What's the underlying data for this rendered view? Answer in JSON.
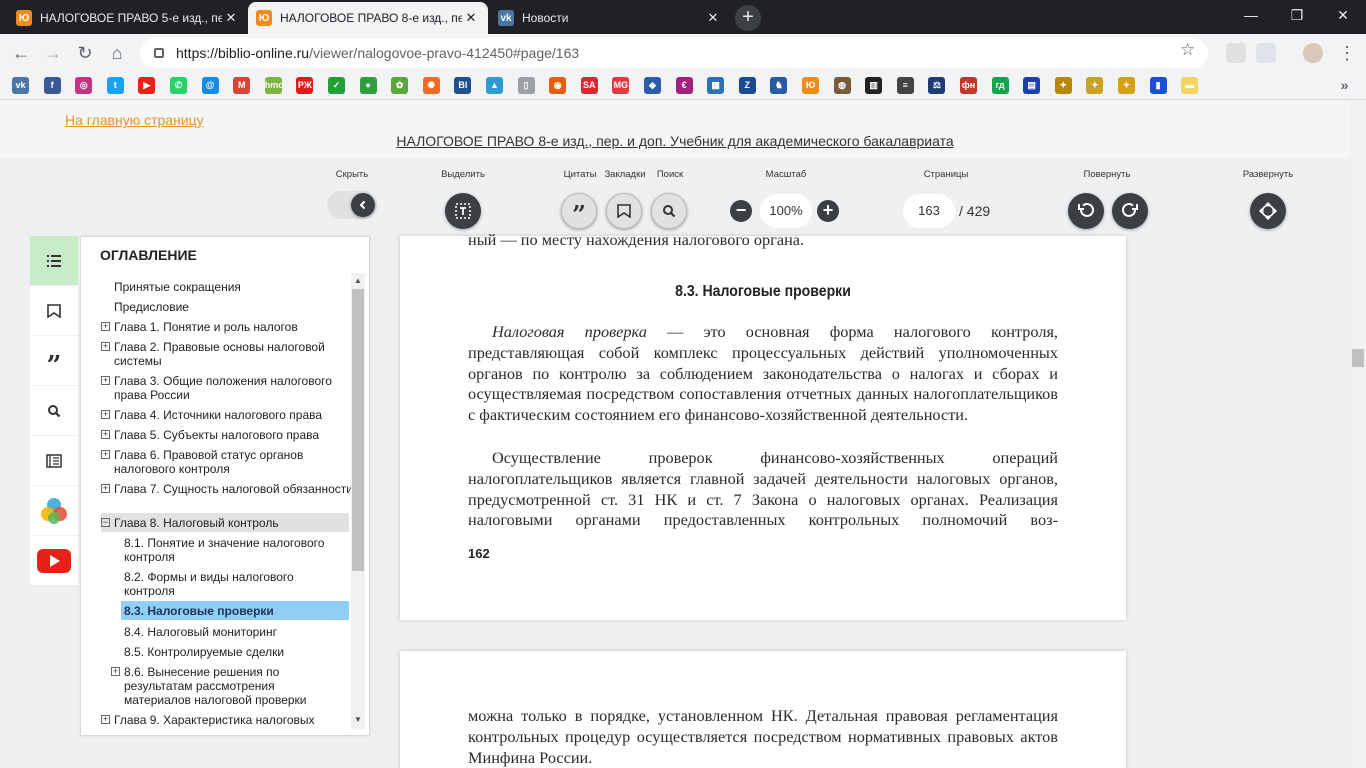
{
  "browser": {
    "tabs": [
      {
        "title": "НАЛОГОВОЕ ПРАВО 5-е изд., пе",
        "close": "✕",
        "active": false,
        "icon_color": "#f08c1e"
      },
      {
        "title": "НАЛОГОВОЕ ПРАВО 8-е изд., пе",
        "close": "✕",
        "active": true,
        "icon_color": "#f08c1e"
      },
      {
        "title": "Новости",
        "close": "✕",
        "active": false,
        "icon_color": "#4a76a8"
      }
    ],
    "new_tab": "+",
    "window_controls": {
      "minimize": "—",
      "maximize": "❐",
      "close": "✕"
    },
    "url_host": "https://biblio-online.ru",
    "url_path": "/viewer/nalogovoe-pravo-412450#page/163",
    "bookmarks": [
      {
        "icon": "vk-icon",
        "color": "#4a76a8",
        "glyph": "vk"
      },
      {
        "icon": "facebook-icon",
        "color": "#3b5998",
        "glyph": "f"
      },
      {
        "icon": "instagram-icon",
        "color": "#c13584",
        "glyph": "◎"
      },
      {
        "icon": "twitter-icon",
        "color": "#1da1f2",
        "glyph": "t"
      },
      {
        "icon": "youtube-icon",
        "color": "#e62117",
        "glyph": "▶"
      },
      {
        "icon": "whatsapp-icon",
        "color": "#25d366",
        "glyph": "✆"
      },
      {
        "icon": "mail-at-icon",
        "color": "#168de2",
        "glyph": "@"
      },
      {
        "icon": "gmail-icon",
        "color": "#d44638",
        "glyph": "M"
      },
      {
        "icon": "hmc-icon",
        "color": "#7cb342",
        "glyph": "hmc"
      },
      {
        "icon": "rzd-icon",
        "color": "#e21a1a",
        "glyph": "РЖ"
      },
      {
        "icon": "sber-icon",
        "color": "#21a038",
        "glyph": "✓"
      },
      {
        "icon": "green-circle-icon",
        "color": "#2e9e3e",
        "glyph": "●"
      },
      {
        "icon": "clover-icon",
        "color": "#5aa83c",
        "glyph": "✿"
      },
      {
        "icon": "orange-gear-icon",
        "color": "#f26b21",
        "glyph": "✺"
      },
      {
        "icon": "biblio-icon",
        "color": "#1f4f8f",
        "glyph": "Bl"
      },
      {
        "icon": "landscape-icon",
        "color": "#2f9bd6",
        "glyph": "▲"
      },
      {
        "icon": "page-icon",
        "color": "#9aa0a6",
        "glyph": "▯"
      },
      {
        "icon": "ring-icon",
        "color": "#e85d0d",
        "glyph": "◉"
      },
      {
        "icon": "sa-icon",
        "color": "#d9282f",
        "glyph": "SA"
      },
      {
        "icon": "mg-icon",
        "color": "#e63946",
        "glyph": "MG"
      },
      {
        "icon": "emblem-icon",
        "color": "#2d5ca8",
        "glyph": "◆"
      },
      {
        "icon": "e-icon",
        "color": "#a3207c",
        "glyph": "€"
      },
      {
        "icon": "grid-icon",
        "color": "#2b73b6",
        "glyph": "▦"
      },
      {
        "icon": "z-icon",
        "color": "#1b4a91",
        "glyph": "Z"
      },
      {
        "icon": "horse-icon",
        "color": "#2a5aa0",
        "glyph": "♞"
      },
      {
        "icon": "yurait-icon",
        "color": "#f08c1e",
        "glyph": "Ю"
      },
      {
        "icon": "seal-icon",
        "color": "#7a5c3a",
        "glyph": "◍"
      },
      {
        "icon": "table-icon",
        "color": "#222222",
        "glyph": "▥"
      },
      {
        "icon": "bars-icon",
        "color": "#444444",
        "glyph": "≡"
      },
      {
        "icon": "court-icon",
        "color": "#1f3b73",
        "glyph": "⚖"
      },
      {
        "icon": "fns-icon",
        "color": "#c0392b",
        "glyph": "фн"
      },
      {
        "icon": "gd-icon",
        "color": "#16a34a",
        "glyph": "гд"
      },
      {
        "icon": "bank-icon",
        "color": "#1e40af",
        "glyph": "▤"
      },
      {
        "icon": "eagle-icon",
        "color": "#b8860b",
        "glyph": "✦"
      },
      {
        "icon": "eagle2-icon",
        "color": "#c9a227",
        "glyph": "✦"
      },
      {
        "icon": "eagle3-icon",
        "color": "#d4a017",
        "glyph": "✦"
      },
      {
        "icon": "book-icon",
        "color": "#1d4ed8",
        "glyph": "▮"
      },
      {
        "icon": "folder-icon",
        "color": "#f6d365",
        "glyph": "▬"
      }
    ]
  },
  "site": {
    "home_link": "На главную страницу",
    "book_title": "НАЛОГОВОЕ ПРАВО 8-е изд., пер. и доп. Учебник для академического бакалавриата"
  },
  "reader_toolbar": {
    "hide_label": "Скрыть",
    "select_label": "Выделить",
    "quotes_label": "Цитаты",
    "bookmarks_label": "Закладки",
    "search_label": "Поиск",
    "zoom_label": "Масштаб",
    "zoom_value": "100%",
    "pages_label": "Страницы",
    "current_page": "163",
    "total_pages": "/ 429",
    "rotate_label": "Повернуть",
    "expand_label": "Развернуть"
  },
  "toc": {
    "title": "ОГЛАВЛЕНИЕ",
    "items": [
      {
        "text": "Принятые сокращения",
        "level": 0,
        "expander": ""
      },
      {
        "text": "Предисловие",
        "level": 0,
        "expander": ""
      },
      {
        "text": "Глава 1. Понятие и роль налогов",
        "level": 0,
        "expander": "+"
      },
      {
        "text": "Глава 2. Правовые основы налоговой системы",
        "level": 0,
        "expander": "+"
      },
      {
        "text": "Глава 3. Общие положения налогового права России",
        "level": 0,
        "expander": "+"
      },
      {
        "text": "Глава 4. Источники налогового права",
        "level": 0,
        "expander": "+"
      },
      {
        "text": "Глава 5. Субъекты налогового права",
        "level": 0,
        "expander": "+"
      },
      {
        "text": "Глава 6. Правовой статус органов налогового контроля",
        "level": 0,
        "expander": "+"
      },
      {
        "text": "Глава 7. Сущность налоговой обязанности",
        "level": 0,
        "expander": "+"
      },
      {
        "text": "Глава 8. Налоговый контроль",
        "level": 0,
        "expander": "−",
        "state": "expanded"
      },
      {
        "text": "8.1. Понятие и значение налогового контроля",
        "level": 1,
        "expander": ""
      },
      {
        "text": "8.2. Формы и виды налогового контроля",
        "level": 1,
        "expander": ""
      },
      {
        "text": "8.3. Налоговые проверки",
        "level": 1,
        "expander": "",
        "state": "selected"
      },
      {
        "text": "8.4. Налоговый мониторинг",
        "level": 1,
        "expander": ""
      },
      {
        "text": "8.5. Контролируемые сделки",
        "level": 1,
        "expander": ""
      },
      {
        "text": "8.6. Вынесение решения по результатам рассмотрения материалов налоговой проверки",
        "level": 1,
        "expander": "+"
      },
      {
        "text": "Глава 9. Характеристика налоговых",
        "level": 0,
        "expander": "+"
      }
    ],
    "scroll_up": "▲",
    "scroll_down": "▼"
  },
  "book": {
    "page1": {
      "top_line": "ный — по месту нахождения налогового органа.",
      "heading": "8.3. Налоговые проверки",
      "p1_term": "Налоговая проверка",
      "p1_rest": " — это основная форма налогового контроля, представляющая собой комплекс процессуальных действий уполномоченных органов по контролю за соблюдением законодательства о налогах и сборах и осуществляемая посредством сопоставления отчетных данных налогоплательщиков с фактическим состоянием его финансово-хозяйственной деятельности.",
      "p2": "Осуществление проверок финансово-хозяйственных операций налогоплательщиков является главной задачей деятельности налоговых органов, предусмотренной ст. 31 НК и ст. 7 Закона о налоговых органах. Реализация налоговыми органами предоставленных контрольных полномочий воз-",
      "page_number": "162"
    },
    "page2": {
      "p1": "можна только в порядке, установленном НК. Детальная правовая регламентация контрольных процедур осуществляется посредством нормативных правовых актов Минфина России."
    }
  }
}
